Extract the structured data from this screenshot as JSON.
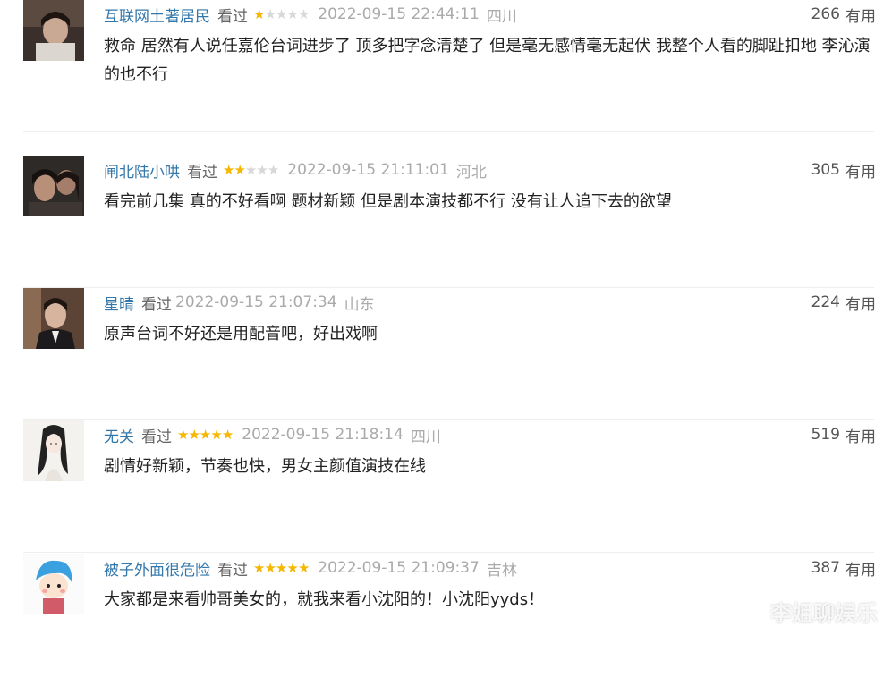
{
  "reviews": [
    {
      "user": "互联网土著居民",
      "watched": "看过",
      "rating": 1,
      "time": "2022-09-15 22:44:11",
      "location": "四川",
      "votes": "266",
      "useful": "有用",
      "content": "救命 居然有人说任嘉伦台词进步了 顶多把字念清楚了 但是毫无感情毫无起伏 我整个人看的脚趾扣地 李沁演的也不行",
      "avatar_icon": "photo-avatar-dark"
    },
    {
      "user": "闸北陆小哄",
      "watched": "看过",
      "rating": 2,
      "time": "2022-09-15 21:11:01",
      "location": "河北",
      "votes": "305",
      "useful": "有用",
      "content": "看完前几集 真的不好看啊 题材新颖 但是剧本演技都不行 没有让人追下去的欲望",
      "avatar_icon": "photo-avatar-couple"
    },
    {
      "user": "星晴",
      "watched": "看过",
      "rating": 0,
      "time": "2022-09-15 21:07:34",
      "location": "山东",
      "votes": "224",
      "useful": "有用",
      "content": "原声台词不好还是用配音吧，好出戏啊",
      "avatar_icon": "photo-avatar-man"
    },
    {
      "user": "无关",
      "watched": "看过",
      "rating": 5,
      "time": "2022-09-15 21:18:14",
      "location": "四川",
      "votes": "519",
      "useful": "有用",
      "content": "剧情好新颖，节奏也快，男女主颜值演技在线",
      "avatar_icon": "drawing-avatar-longhair"
    },
    {
      "user": "被子外面很危险",
      "watched": "看过",
      "rating": 5,
      "time": "2022-09-15 21:09:37",
      "location": "吉林",
      "votes": "387",
      "useful": "有用",
      "content": "大家都是来看帅哥美女的，就我来看小沈阳的！小沈阳yyds！",
      "avatar_icon": "cartoon-avatar-bluehair"
    }
  ],
  "watermark": "李姐聊娱乐",
  "colors": {
    "username": "#3377aa",
    "star_on": "#f5b700",
    "star_off": "#d8d8d8",
    "meta_gray": "#aaaaaa"
  }
}
